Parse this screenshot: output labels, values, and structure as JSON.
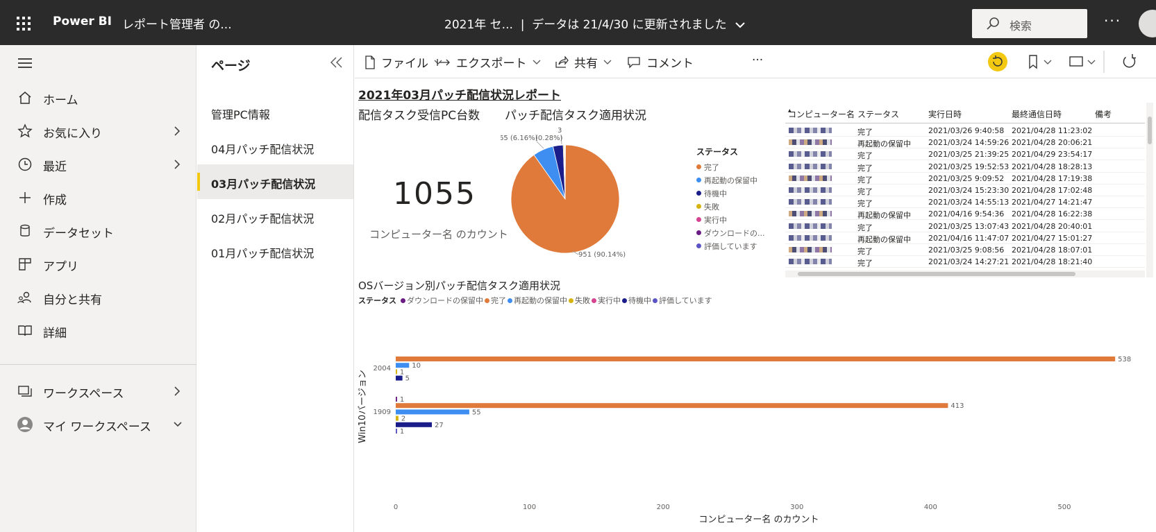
{
  "topbar": {
    "brand": "Power BI",
    "report_name": "レポート管理者 の...",
    "center_title": "2021年 セ...",
    "updated": "データは 21/4/30 に更新されました",
    "search_placeholder": "検索",
    "more": "···"
  },
  "nav": {
    "items": [
      {
        "label": "ホーム",
        "icon": "home-icon"
      },
      {
        "label": "お気に入り",
        "icon": "star-icon",
        "chevron": true
      },
      {
        "label": "最近",
        "icon": "clock-icon",
        "chevron": true
      },
      {
        "label": "作成",
        "icon": "plus-icon"
      },
      {
        "label": "データセット",
        "icon": "database-icon"
      },
      {
        "label": "アプリ",
        "icon": "apps-icon"
      },
      {
        "label": "自分と共有",
        "icon": "shared-people-icon"
      },
      {
        "label": "詳細",
        "icon": "book-icon"
      }
    ],
    "workspaces": "ワークスペース",
    "my_workspace": "マイ ワークスペース"
  },
  "pages": {
    "title": "ページ",
    "items": [
      "管理PC情報",
      "04月パッチ配信状況",
      "03月パッチ配信状況",
      "02月パッチ配信状況",
      "01月パッチ配信状況"
    ],
    "active_index": 2
  },
  "toolbar": {
    "file": "ファイル",
    "export": "エクスポート",
    "share": "共有",
    "comment": "コメント",
    "more": "···"
  },
  "report": {
    "title": "2021年03月パッチ配信状況レポート",
    "card_title": "配信タスク受信PC台数",
    "card_value": "1055",
    "card_label": "コンピューター名 のカウント",
    "pie_title": "パッチ配信タスク適用状況",
    "pie_legend_title": "ステータス",
    "bar_title": "OSバージョン別パッチ配信タスク適用状況",
    "bar_legend_title": "ステータス"
  },
  "colors": {
    "完了": "#e07a3a",
    "再起動の保留中": "#3d8ef0",
    "待機中": "#1a1d8a",
    "失敗": "#d6b40d",
    "実行中": "#d64390",
    "ダウンロードの保留中": "#6b1c84",
    "評価しています": "#5b54c4"
  },
  "table": {
    "headers": [
      "コンピューター名",
      "ステータス",
      "実行日時",
      "最終通信日時",
      "備考"
    ],
    "rows": [
      [
        "完了",
        "2021/03/26 9:40:58",
        "2021/04/28 11:23:02"
      ],
      [
        "再起動の保留中",
        "2021/03/24 14:59:26",
        "2021/04/28 20:06:21"
      ],
      [
        "完了",
        "2021/03/25 21:39:25",
        "2021/04/29 23:54:17"
      ],
      [
        "完了",
        "2021/03/25 19:52:53",
        "2021/04/28 18:28:13"
      ],
      [
        "完了",
        "2021/03/25 9:09:52",
        "2021/04/28 17:19:38"
      ],
      [
        "完了",
        "2021/03/24 15:23:30",
        "2021/04/28 17:02:48"
      ],
      [
        "完了",
        "2021/03/24 14:55:13",
        "2021/04/27 14:21:47"
      ],
      [
        "再起動の保留中",
        "2021/04/16 9:54:36",
        "2021/04/28 16:22:38"
      ],
      [
        "完了",
        "2021/03/25 13:07:43",
        "2021/04/28 20:40:01"
      ],
      [
        "再起動の保留中",
        "2021/04/16 11:47:07",
        "2021/04/27 15:01:27"
      ],
      [
        "完了",
        "2021/03/25 9:08:56",
        "2021/04/28 18:07:01"
      ],
      [
        "完了",
        "2021/03/24 14:27:21",
        "2021/04/28 18:21:40"
      ]
    ]
  },
  "chart_data": [
    {
      "type": "pie",
      "legend_title": "ステータス",
      "legend_position": "right",
      "categories": [
        "完了",
        "再起動の保留中",
        "待機中",
        "失敗",
        "実行中",
        "ダウンロードの保留中",
        "評価しています"
      ],
      "values": [
        951,
        65,
        32,
        3,
        2,
        1,
        1
      ],
      "data_labels": [
        {
          "text": "951 (90.14%)"
        },
        {
          "text": "65 (6.16%)"
        },
        {
          "text": "3"
        },
        {
          "text": "(0.28%)"
        }
      ]
    },
    {
      "type": "bar",
      "orientation": "horizontal",
      "legend_title": "ステータス",
      "legend_position": "top-left",
      "legend_order": [
        "ダウンロードの保留中",
        "完了",
        "再起動の保留中",
        "失敗",
        "実行中",
        "待機中",
        "評価しています"
      ],
      "ylabel": "Win10バージョン",
      "xlabel": "コンピューター名 のカウント",
      "categories": [
        "2004",
        "1909"
      ],
      "xticks": [
        0,
        100,
        200,
        300,
        400,
        500
      ],
      "xlim": [
        0,
        540
      ],
      "series": [
        {
          "name": "ダウンロードの保留中",
          "values": [
            null,
            1
          ]
        },
        {
          "name": "完了",
          "values": [
            538,
            413
          ]
        },
        {
          "name": "再起動の保留中",
          "values": [
            10,
            55
          ]
        },
        {
          "name": "失敗",
          "values": [
            1,
            2
          ]
        },
        {
          "name": "待機中",
          "values": [
            5,
            27
          ]
        },
        {
          "name": "評価しています",
          "values": [
            null,
            1
          ]
        }
      ]
    }
  ]
}
